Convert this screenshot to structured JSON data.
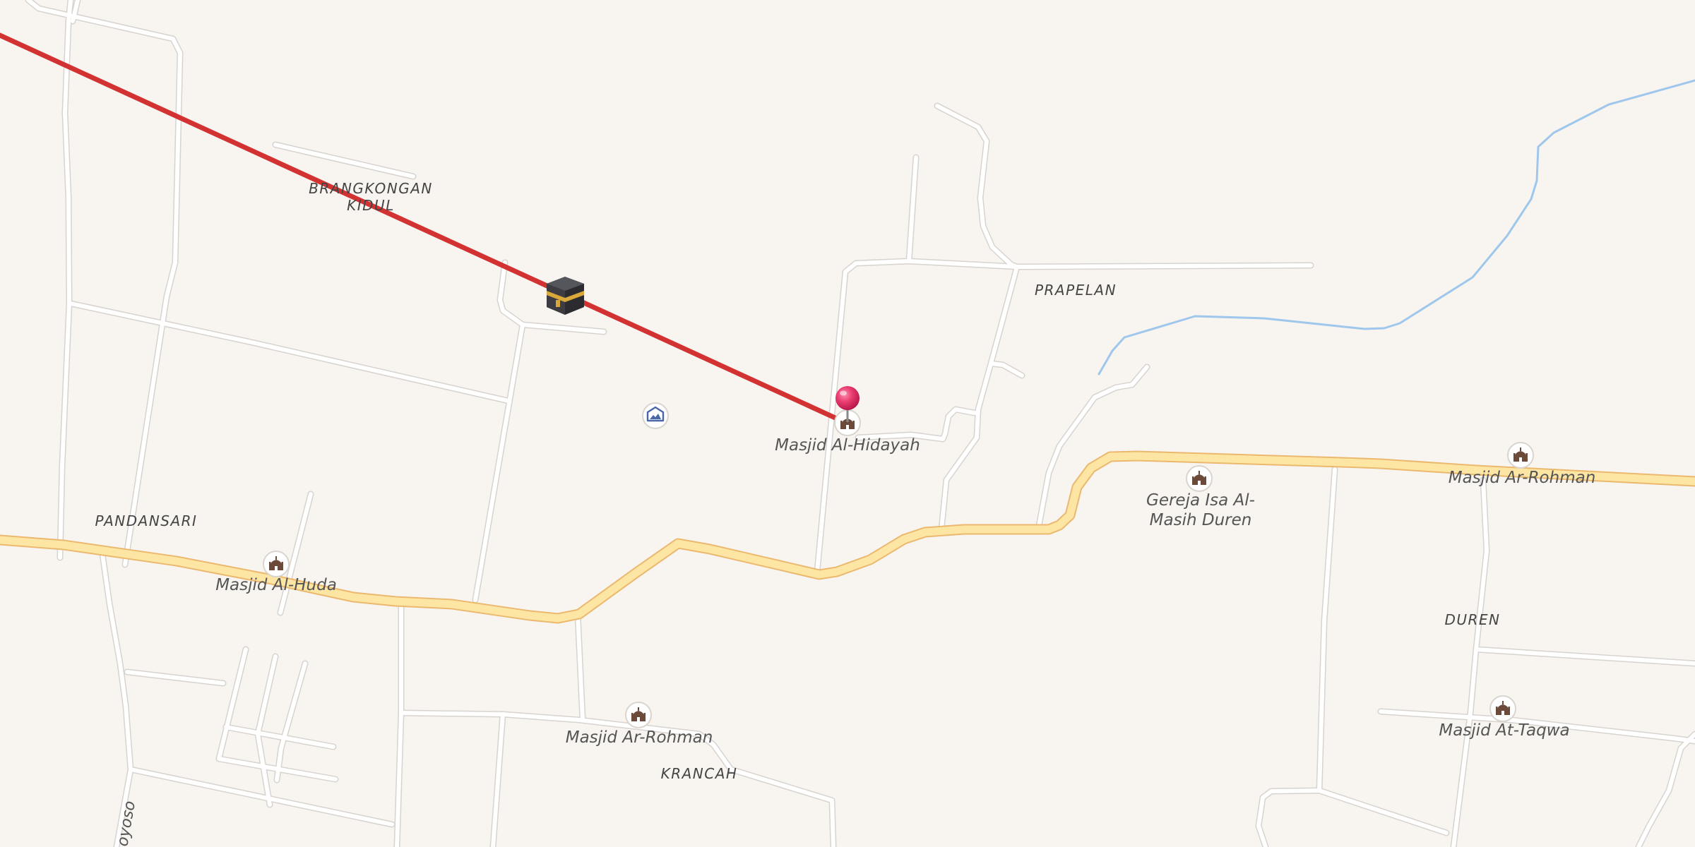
{
  "map": {
    "colors": {
      "background": "#f8f5f1",
      "road_fill": "#ffffff",
      "road_casing": "#d7d3cf",
      "main_road_fill": "#fde6a4",
      "main_road_casing": "#ebb86e",
      "river": "#9fc7ec",
      "route_line": "#d33232",
      "pin": "#e8356a",
      "poi_icon": "#6b4a3a"
    },
    "places": {
      "brangkongan_1": "BRANGKONGAN",
      "brangkongan_2": "KIDUL",
      "prapelan": "PRAPELAN",
      "pandansari": "PANDANSARI",
      "duren": "DUREN",
      "krancah": "KRANCAH"
    },
    "pois": {
      "masjid_al_hidayah": "Masjid Al-Hidayah",
      "masjid_al_huda": "Masjid Al-Huda",
      "masjid_ar_rohman_south": "Masjid Ar-Rohman",
      "masjid_ar_rohman_east": "Masjid Ar-Rohman",
      "masjid_at_taqwa": "Masjid At-Taqwa",
      "gereja_1": "Gereja Isa Al-",
      "gereja_2": "Masih Duren"
    },
    "road_label": "oyoso",
    "icons": {
      "kaaba": "kaaba-icon",
      "location_pin": "location-pin-icon",
      "mosque": "mosque-icon",
      "church": "church-icon",
      "gallery": "gallery-icon"
    }
  }
}
